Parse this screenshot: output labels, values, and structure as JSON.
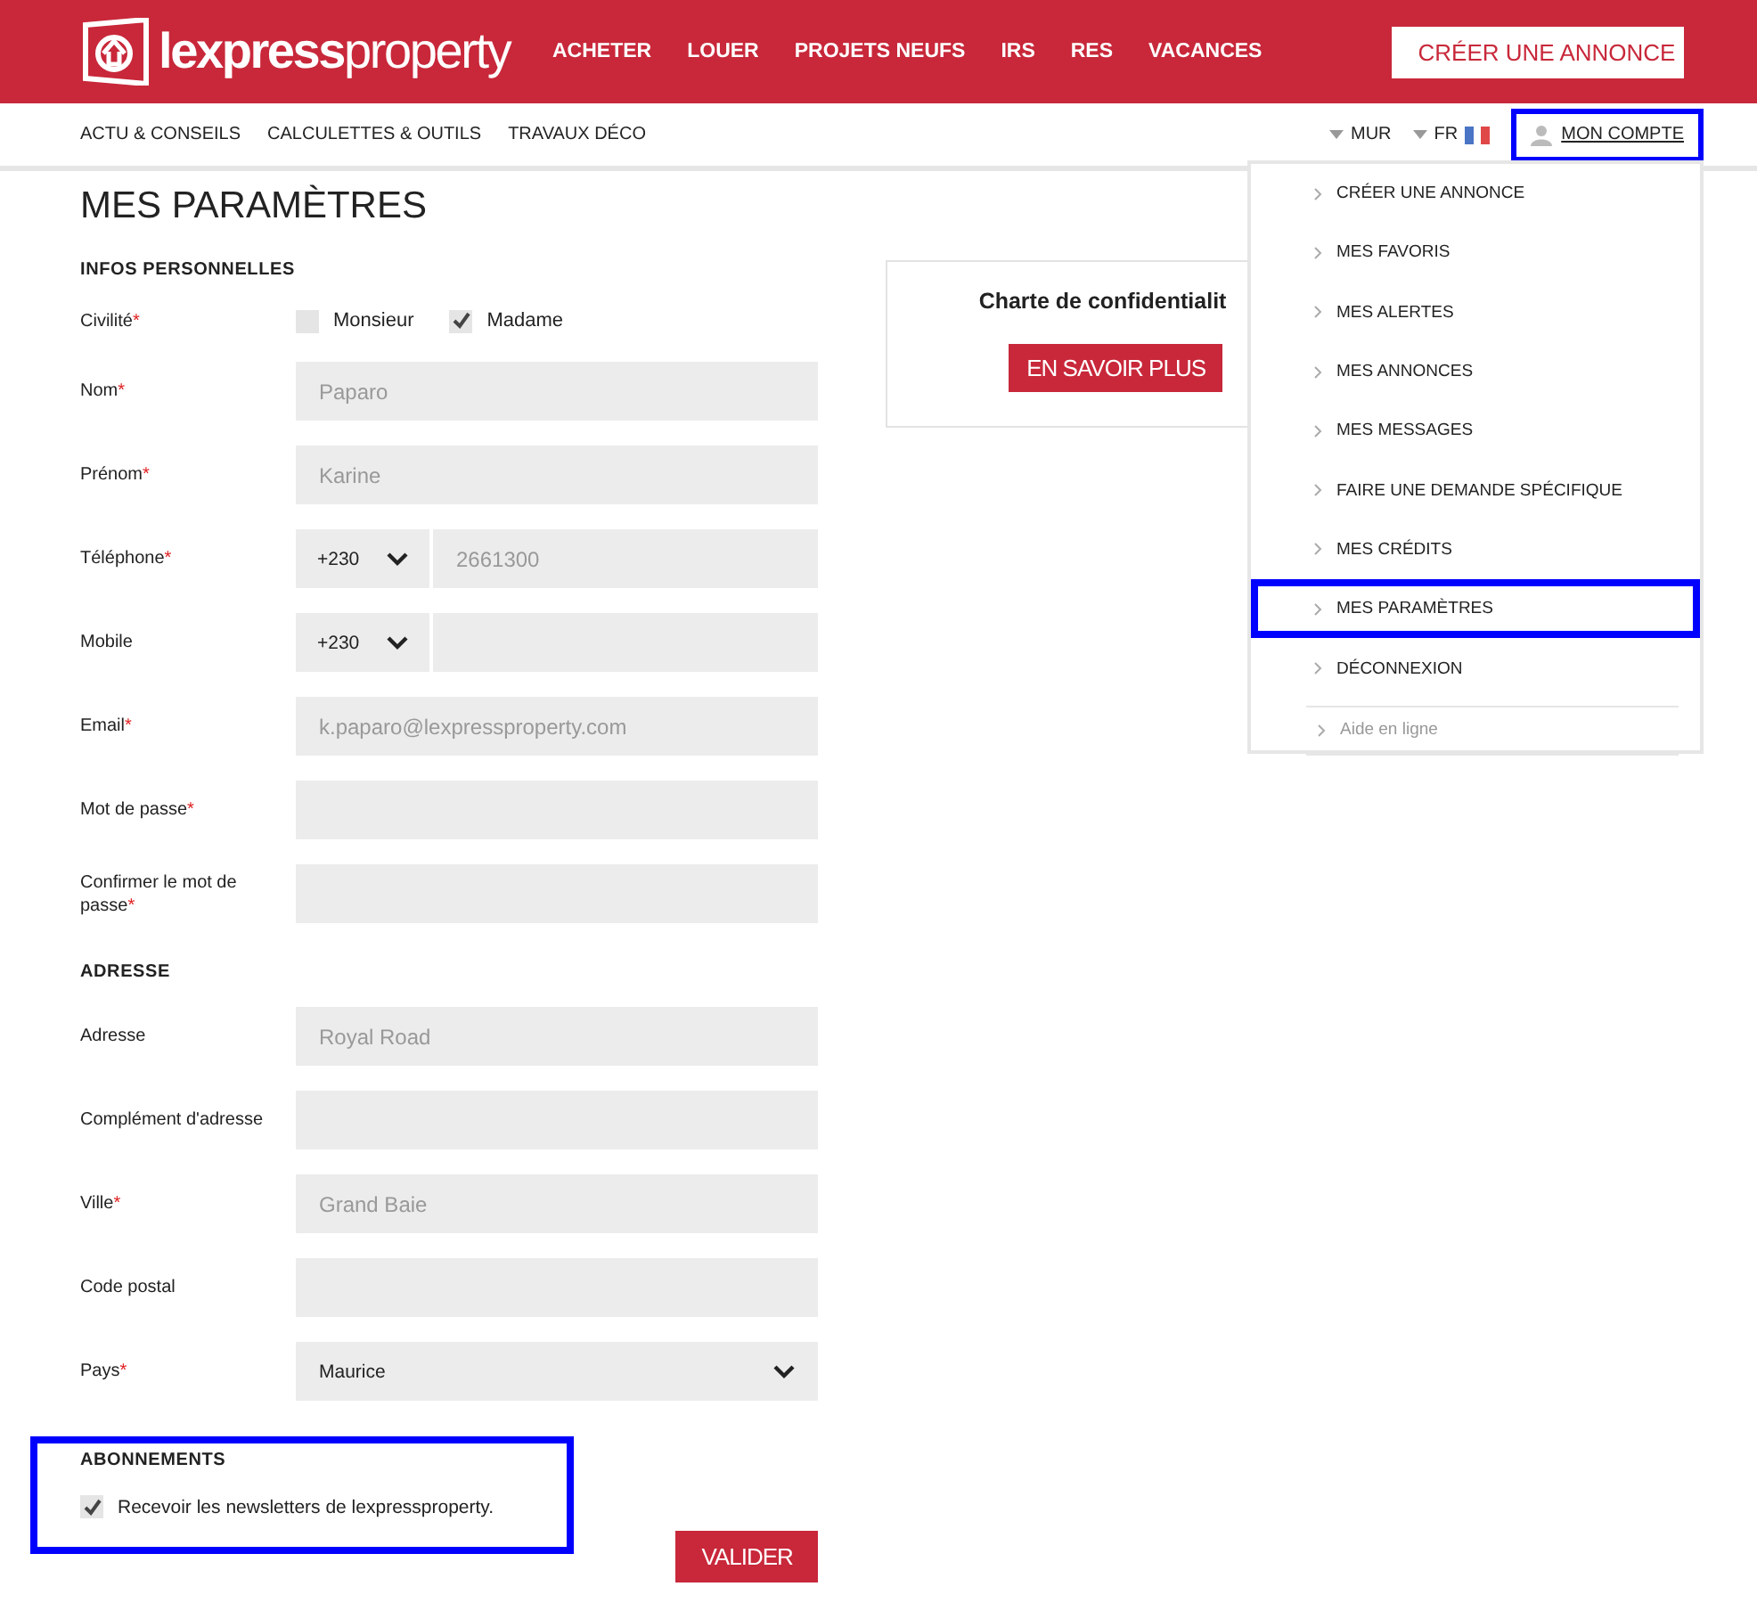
{
  "header": {
    "logo": "**lexpress**property",
    "nav": [
      "ACHETER",
      "LOUER",
      "PROJETS NEUFS",
      "IRS",
      "RES",
      "VACANCES"
    ],
    "create_button": "CRÉER UNE ANNONCE"
  },
  "subnav": {
    "links": [
      "ACTU & CONSEILS",
      "CALCULETTES & OUTILS",
      "TRAVAUX DÉCO"
    ],
    "currency": "MUR",
    "language": "FR",
    "account": {
      "label": "MON COMPTE",
      "highlighted": true
    }
  },
  "account_menu": {
    "items": [
      {
        "label": "CRÉER UNE ANNONCE",
        "highlighted": false
      },
      {
        "label": "MES FAVORIS",
        "highlighted": false
      },
      {
        "label": "MES ALERTES",
        "highlighted": false
      },
      {
        "label": "MES ANNONCES",
        "highlighted": false
      },
      {
        "label": "MES MESSAGES",
        "highlighted": false
      },
      {
        "label": "FAIRE UNE DEMANDE SPÉCIFIQUE",
        "highlighted": false
      },
      {
        "label": "MES CRÉDITS",
        "highlighted": false
      },
      {
        "label": "MES PARAMÈTRES",
        "highlighted": true
      },
      {
        "label": "DÉCONNEXION",
        "highlighted": false
      }
    ],
    "help": "Aide en ligne"
  },
  "page_title": "MES PARAMÈTRES",
  "sections": [
    {
      "title": "INFOS PERSONNELLES",
      "highlighted": false,
      "rows": [
        {
          "kind": "choice",
          "label": "Civilité",
          "required_mark": "*",
          "options": [
            {
              "label": "Monsieur",
              "selected": false
            },
            {
              "label": "Madame",
              "selected": true
            }
          ]
        },
        {
          "kind": "text",
          "label": "Nom",
          "required_mark": "*",
          "value": "Paparo"
        },
        {
          "kind": "text",
          "label": "Prénom",
          "required_mark": "*",
          "value": "Karine"
        },
        {
          "kind": "phone",
          "label": "Téléphone",
          "required_mark": "*",
          "code": "+230",
          "value": "2661300"
        },
        {
          "kind": "phone",
          "label": "Mobile",
          "code": "+230"
        },
        {
          "kind": "text",
          "label": "Email",
          "required_mark": "*",
          "value": "k.paparo@lexpressproperty.com"
        },
        {
          "kind": "text",
          "label": "Mot de passe",
          "required_mark": "*"
        },
        {
          "kind": "text",
          "label": "Confirmer le mot de passe",
          "required_mark": "*"
        }
      ]
    },
    {
      "title": "ADRESSE",
      "highlighted": false,
      "rows": [
        {
          "kind": "text",
          "label": "Adresse",
          "value": "Royal Road"
        },
        {
          "kind": "text",
          "label": "Complément d'adresse"
        },
        {
          "kind": "text",
          "label": "Ville",
          "required_mark": "*",
          "value": "Grand Baie"
        },
        {
          "kind": "text",
          "label": "Code postal"
        },
        {
          "kind": "select",
          "label": "Pays",
          "required_mark": "*",
          "value": "Maurice"
        }
      ]
    },
    {
      "title": "ABONNEMENTS",
      "highlighted": true,
      "rows": [
        {
          "kind": "checkbox",
          "label": "Recevoir les newsletters de lexpressproperty.",
          "checked": true
        }
      ]
    }
  ],
  "submit": "VALIDER",
  "privacy_card": {
    "title": "Charte de confidentialit",
    "button": "EN SAVOIR PLUS"
  }
}
